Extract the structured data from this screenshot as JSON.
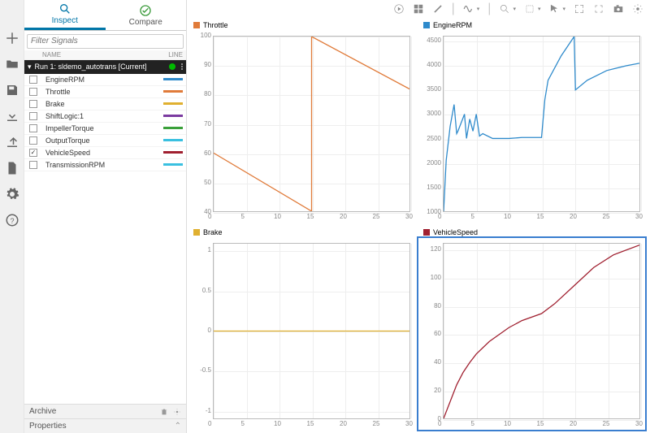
{
  "tabs": {
    "inspect": "Inspect",
    "compare": "Compare"
  },
  "filter_placeholder": "Filter Signals",
  "columns": {
    "name": "NAME",
    "line": "LINE"
  },
  "run_header": "Run 1: sldemo_autotrans [Current]",
  "signals": [
    {
      "name": "EngineRPM",
      "color": "#2e8acb",
      "checked": false
    },
    {
      "name": "Throttle",
      "color": "#e07b3a",
      "checked": false
    },
    {
      "name": "Brake",
      "color": "#e0b030",
      "checked": false
    },
    {
      "name": "ShiftLogic:1",
      "color": "#7b3aa0",
      "checked": false
    },
    {
      "name": "ImpellerTorque",
      "color": "#3aa03a",
      "checked": false
    },
    {
      "name": "OutputTorque",
      "color": "#3ac0e0",
      "checked": false
    },
    {
      "name": "VehicleSpeed",
      "color": "#a02030",
      "checked": true
    },
    {
      "name": "TransmissionRPM",
      "color": "#3ac0e0",
      "checked": false
    }
  ],
  "panels": {
    "archive": "Archive",
    "properties": "Properties"
  },
  "charts": [
    {
      "title": "Throttle",
      "color": "#e07b3a"
    },
    {
      "title": "EngineRPM",
      "color": "#2e8acb"
    },
    {
      "title": "Brake",
      "color": "#e0b030"
    },
    {
      "title": "VehicleSpeed",
      "color": "#a02030"
    }
  ],
  "chart_data": [
    {
      "type": "line",
      "title": "Throttle",
      "series": [
        {
          "name": "Throttle",
          "color": "#e07b3a",
          "x": [
            0,
            15,
            15,
            30
          ],
          "y": [
            60,
            40,
            100,
            82
          ]
        }
      ],
      "xlim": [
        0,
        30
      ],
      "ylim": [
        40,
        100
      ],
      "xticks": [
        0,
        5,
        10,
        15,
        20,
        25,
        30
      ],
      "yticks": [
        40,
        50,
        60,
        70,
        80,
        90,
        100
      ]
    },
    {
      "type": "line",
      "title": "EngineRPM",
      "series": [
        {
          "name": "EngineRPM",
          "color": "#2e8acb",
          "x": [
            0,
            0.4,
            1,
            1.6,
            2,
            2.2,
            3.2,
            3.5,
            4,
            4.5,
            5,
            5.5,
            6,
            7.5,
            10,
            12,
            15,
            15.5,
            16,
            18,
            20,
            20.2,
            22,
            25,
            28,
            30
          ],
          "y": [
            1000,
            2050,
            2750,
            3200,
            2600,
            2650,
            3000,
            2500,
            2900,
            2650,
            3000,
            2550,
            2600,
            2500,
            2500,
            2520,
            2520,
            3300,
            3700,
            4200,
            4600,
            3500,
            3700,
            3900,
            4000,
            4050
          ]
        }
      ],
      "xlim": [
        0,
        30
      ],
      "ylim": [
        1000,
        4600
      ],
      "xticks": [
        0,
        5,
        10,
        15,
        20,
        25,
        30
      ],
      "yticks": [
        1000,
        1500,
        2000,
        2500,
        3000,
        3500,
        4000,
        4500
      ]
    },
    {
      "type": "line",
      "title": "Brake",
      "series": [
        {
          "name": "Brake",
          "color": "#e0b030",
          "x": [
            0,
            30
          ],
          "y": [
            0,
            0
          ]
        }
      ],
      "xlim": [
        0,
        30
      ],
      "ylim": [
        -1.1,
        1.1
      ],
      "xticks": [
        0,
        5,
        10,
        15,
        20,
        25,
        30
      ],
      "yticks": [
        -1.0,
        -0.5,
        0,
        0.5,
        1.0
      ]
    },
    {
      "type": "line",
      "title": "VehicleSpeed",
      "series": [
        {
          "name": "VehicleSpeed",
          "color": "#a02030",
          "x": [
            0,
            1,
            2,
            3,
            4,
            5,
            7,
            10,
            12,
            15,
            17,
            20,
            23,
            26,
            30
          ],
          "y": [
            0,
            12,
            24,
            33,
            40,
            46,
            55,
            65,
            70,
            75,
            82,
            95,
            108,
            117,
            124
          ]
        }
      ],
      "xlim": [
        0,
        30
      ],
      "ylim": [
        0,
        125
      ],
      "xticks": [
        0,
        5,
        10,
        15,
        20,
        25,
        30
      ],
      "yticks": [
        0,
        20,
        40,
        60,
        80,
        100,
        120
      ]
    }
  ]
}
